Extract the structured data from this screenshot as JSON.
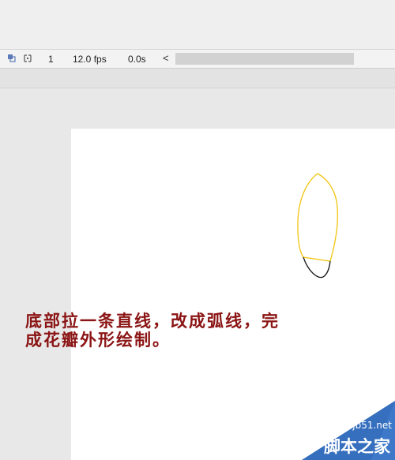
{
  "timeline": {
    "frame": "1",
    "fps": "12.0 fps",
    "time": "0.0s",
    "scroll_left": "<"
  },
  "annotation": {
    "line1": "底部拉一条直线，改成弧线，完",
    "line2": "成花瓣外形绘制。"
  },
  "watermark": {
    "domain": "jb51.net",
    "name": "脚本之家"
  },
  "colors": {
    "petal_outline": "#f2c40e",
    "petal_arc": "#1a1a1a",
    "caption": "#8b1414",
    "watermark_bg": "#3d78c9"
  }
}
